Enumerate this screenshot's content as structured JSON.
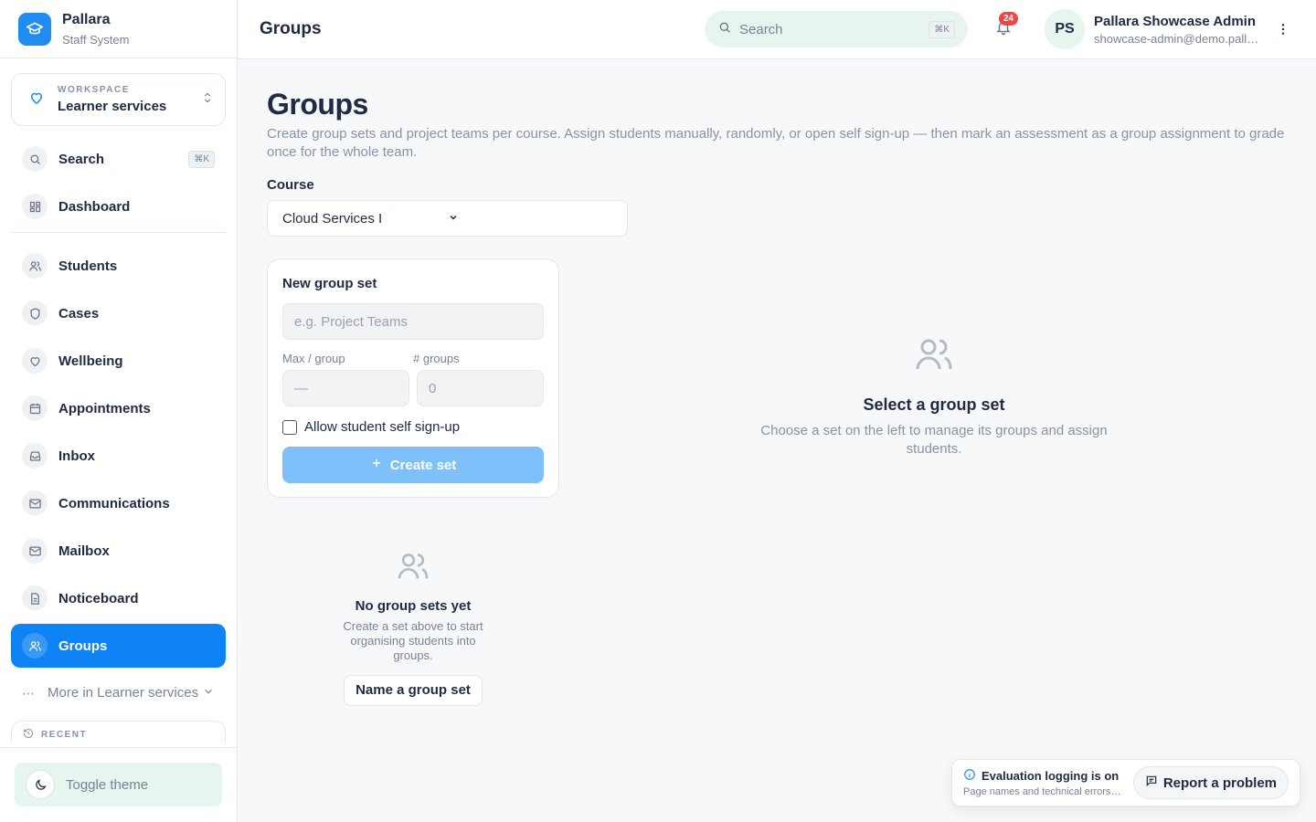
{
  "brand": {
    "name": "Pallara",
    "subtitle": "Staff System"
  },
  "workspace": {
    "label": "WORKSPACE",
    "value": "Learner services"
  },
  "sidebar": {
    "search": {
      "label": "Search",
      "shortcut": "⌘K"
    },
    "dashboard": {
      "label": "Dashboard"
    },
    "items": [
      {
        "label": "Students",
        "icon": "users-icon"
      },
      {
        "label": "Cases",
        "icon": "shield-icon"
      },
      {
        "label": "Wellbeing",
        "icon": "heart-icon"
      },
      {
        "label": "Appointments",
        "icon": "calendar-icon"
      },
      {
        "label": "Inbox",
        "icon": "inbox-icon"
      },
      {
        "label": "Communications",
        "icon": "mail-icon"
      },
      {
        "label": "Mailbox",
        "icon": "mail-icon"
      },
      {
        "label": "Noticeboard",
        "icon": "document-icon"
      },
      {
        "label": "Groups",
        "icon": "users-icon",
        "active": true
      }
    ],
    "more": {
      "label": "More in Learner services"
    },
    "recent": {
      "label": "RECENT"
    },
    "toggle_theme": {
      "label": "Toggle theme"
    }
  },
  "header": {
    "title": "Groups",
    "search_placeholder": "Search",
    "search_shortcut": "⌘K",
    "notification_count": "24",
    "avatar_initials": "PS",
    "user_name": "Pallara Showcase Admin",
    "user_email": "showcase-admin@demo.pallara.edu"
  },
  "main": {
    "title": "Groups",
    "description": "Create group sets and project teams per course. Assign students manually, randomly, or open self sign-up — then mark an assessment as a group assignment to grade once for the whole team.",
    "course_label": "Course",
    "course_value": "Cloud Services I",
    "new_set": {
      "title": "New group set",
      "name_placeholder": "e.g. Project Teams",
      "max_label": "Max / group",
      "max_placeholder": "—",
      "groups_label": "# groups",
      "groups_value": "0",
      "self_signup_label": "Allow student self sign-up",
      "self_signup_checked": false,
      "create_label": "Create set"
    },
    "empty_sets": {
      "title": "No group sets yet",
      "description": "Create a set above to start organising students into groups.",
      "button": "Name a group set"
    },
    "select_prompt": {
      "title": "Select a group set",
      "description": "Choose a set on the left to manage its groups and assign students."
    }
  },
  "toast": {
    "title": "Evaluation logging is on",
    "subtitle": "Page names and technical errors are recorded",
    "button": "Report a problem"
  },
  "colors": {
    "accent": "#0e83f5",
    "accent_light": "#7ec0fa",
    "mint": "#e6f5ee",
    "badge": "#ef4444"
  }
}
